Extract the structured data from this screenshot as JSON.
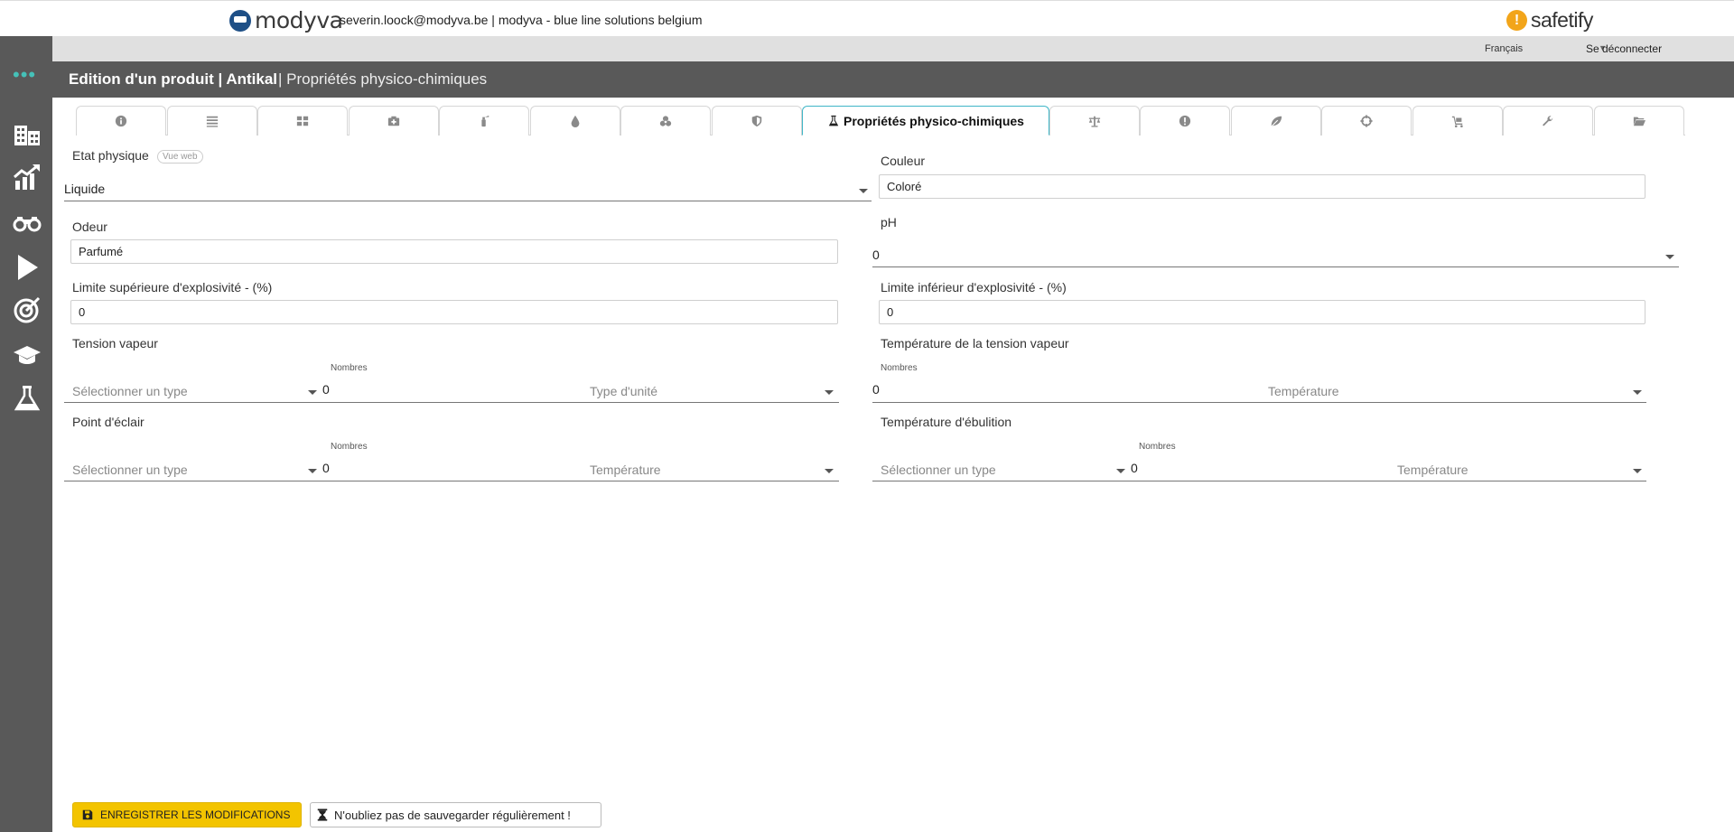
{
  "header": {
    "brand_name": "modyva",
    "user_line": "severin.loock@modyva.be | modyva - blue line solutions belgium",
    "partner_name": "safetify",
    "partner_mark": "!"
  },
  "subbar": {
    "language": "Français",
    "logout": "Se déconnecter"
  },
  "titlebar": {
    "title": "Edition d'un produit | Antikal",
    "section": "| Propriétés physico-chimiques"
  },
  "tabs": {
    "active_label": "Propriétés physico-chimiques",
    "icons": [
      "info-icon",
      "list-icon",
      "grid-icon",
      "first-aid-icon",
      "extinguisher-icon",
      "drop-icon",
      "biohazard-icon",
      "shield-icon",
      "flask-icon",
      "balance-icon",
      "warning-icon",
      "leaf-icon",
      "target-icon",
      "cart-icon",
      "wrench-icon",
      "folder-icon"
    ]
  },
  "form": {
    "etat_physique": {
      "label": "Etat physique",
      "badge": "Vue web",
      "value": "Liquide"
    },
    "couleur": {
      "label": "Couleur",
      "value": "Coloré"
    },
    "odeur": {
      "label": "Odeur",
      "value": "Parfumé"
    },
    "ph": {
      "label": "pH",
      "value": "0"
    },
    "lse": {
      "label": "Limite supérieure d'explosivité - (%)",
      "value": "0"
    },
    "lie": {
      "label": "Limite inférieur d'explosivité - (%)",
      "value": "0"
    },
    "tension_vapeur": {
      "label": "Tension vapeur",
      "type_placeholder": "Sélectionner un type",
      "nombres_label": "Nombres",
      "value": "0",
      "unit_placeholder": "Type d'unité"
    },
    "temp_tension_vapeur": {
      "label": "Température de la tension vapeur",
      "nombres_label": "Nombres",
      "value": "0",
      "unit_placeholder": "Température"
    },
    "point_eclair": {
      "label": "Point d'éclair",
      "type_placeholder": "Sélectionner un type",
      "nombres_label": "Nombres",
      "value": "0",
      "unit_placeholder": "Température"
    },
    "temp_ebullition": {
      "label": "Température d'ébulition",
      "type_placeholder": "Sélectionner un type",
      "nombres_label": "Nombres",
      "value": "0",
      "unit_placeholder": "Température"
    }
  },
  "footer": {
    "save_label": "ENREGISTRER LES MODIFICATIONS",
    "reminder": "N'oubliez pas de sauvegarder régulièrement !"
  },
  "colors": {
    "sidebar": "#595959",
    "accent_teal": "#45c1b8",
    "save_yellow": "#f3c400",
    "active_tab_border": "#3fb6c7",
    "brand_blue": "#1e4f86",
    "safetify_orange": "#f2a51a"
  }
}
